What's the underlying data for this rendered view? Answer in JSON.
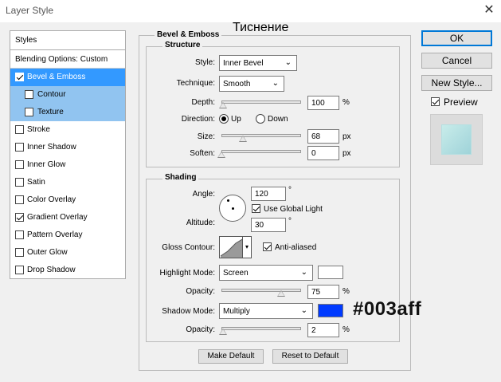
{
  "window": {
    "title": "Layer Style",
    "close_glyph": "✕"
  },
  "annotation": {
    "section_title_ru": "Тиснение",
    "hex_note": "#003aff"
  },
  "styles_panel": {
    "header": "Styles",
    "blending_options": "Blending Options: Custom",
    "items": [
      {
        "label": "Bevel & Emboss",
        "checked": true,
        "selected": true
      },
      {
        "label": "Contour",
        "checked": false,
        "sub": true
      },
      {
        "label": "Texture",
        "checked": false,
        "sub": true
      },
      {
        "label": "Stroke",
        "checked": false
      },
      {
        "label": "Inner Shadow",
        "checked": false
      },
      {
        "label": "Inner Glow",
        "checked": false
      },
      {
        "label": "Satin",
        "checked": false
      },
      {
        "label": "Color Overlay",
        "checked": false
      },
      {
        "label": "Gradient Overlay",
        "checked": true
      },
      {
        "label": "Pattern Overlay",
        "checked": false
      },
      {
        "label": "Outer Glow",
        "checked": false
      },
      {
        "label": "Drop Shadow",
        "checked": false
      }
    ]
  },
  "bevel": {
    "group_label": "Bevel & Emboss",
    "structure": {
      "label": "Structure",
      "style_label": "Style:",
      "style_value": "Inner Bevel",
      "technique_label": "Technique:",
      "technique_value": "Smooth",
      "depth_label": "Depth:",
      "depth_value": "100",
      "depth_unit": "%",
      "depth_level": 0.02,
      "direction_label": "Direction:",
      "direction_up": "Up",
      "direction_down": "Down",
      "direction_selected": "Up",
      "size_label": "Size:",
      "size_value": "68",
      "size_unit": "px",
      "size_level": 0.27,
      "soften_label": "Soften:",
      "soften_value": "0",
      "soften_unit": "px",
      "soften_level": 0.0
    },
    "shading": {
      "label": "Shading",
      "angle_label": "Angle:",
      "angle_value": "120",
      "angle_unit": "°",
      "use_global_light": "Use Global Light",
      "use_global_light_checked": true,
      "altitude_label": "Altitude:",
      "altitude_value": "30",
      "altitude_unit": "°",
      "gloss_contour_label": "Gloss Contour:",
      "anti_aliased": "Anti-aliased",
      "anti_aliased_checked": true,
      "highlight_mode_label": "Highlight Mode:",
      "highlight_mode_value": "Screen",
      "highlight_color": "#ffffff",
      "highlight_opacity_label": "Opacity:",
      "highlight_opacity_value": "75",
      "highlight_opacity_unit": "%",
      "highlight_opacity_level": 0.75,
      "shadow_mode_label": "Shadow Mode:",
      "shadow_mode_value": "Multiply",
      "shadow_color": "#003aff",
      "shadow_opacity_label": "Opacity:",
      "shadow_opacity_value": "2",
      "shadow_opacity_unit": "%",
      "shadow_opacity_level": 0.02
    },
    "make_default": "Make Default",
    "reset_default": "Reset to Default"
  },
  "buttons": {
    "ok": "OK",
    "cancel": "Cancel",
    "new_style": "New Style...",
    "preview": "Preview",
    "preview_checked": true
  },
  "colors": {
    "selection": "#3399ff",
    "sub_selection": "#91c4f0",
    "accent": "#0078d7"
  }
}
